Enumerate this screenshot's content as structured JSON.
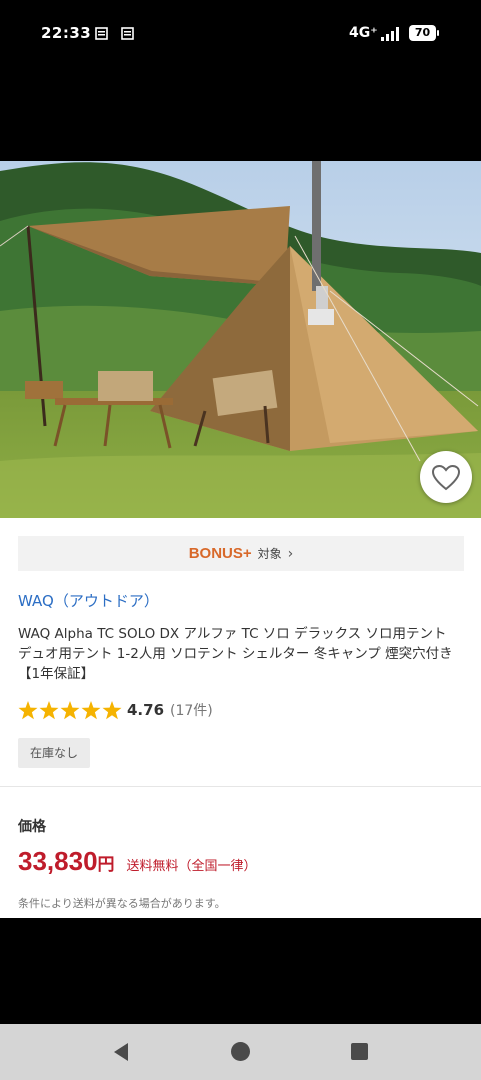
{
  "status_bar": {
    "time": "22:33",
    "network": "4G⁺",
    "battery": "70"
  },
  "product": {
    "bonus_logo": "BONUS+",
    "bonus_label": "対象",
    "brand": "WAQ（アウトドア）",
    "title": "WAQ Alpha TC SOLO DX アルファ TC ソロ デラックス ソロ用テント デュオ用テント 1-2人用 ソロテント シェルター 冬キャンプ 煙突穴付き 【1年保証】",
    "rating": {
      "score": "4.76",
      "count": "(17件)",
      "stars": 5
    },
    "stock": "在庫なし",
    "price_label": "価格",
    "price": "33,830",
    "price_unit": "円",
    "shipping": "送料無料（全国一律）",
    "shipping_note": "条件により送料が異なる場合があります。"
  },
  "colors": {
    "accent": "#bf1c2b",
    "brand_link": "#2c6ec4",
    "bonus": "#d8692a",
    "star": "#f5b301"
  },
  "icons": [
    "notification-icon",
    "signal-icon",
    "battery-icon",
    "heart-icon",
    "star-icon",
    "chevron-right-icon",
    "back-icon",
    "home-icon",
    "recent-apps-icon"
  ]
}
